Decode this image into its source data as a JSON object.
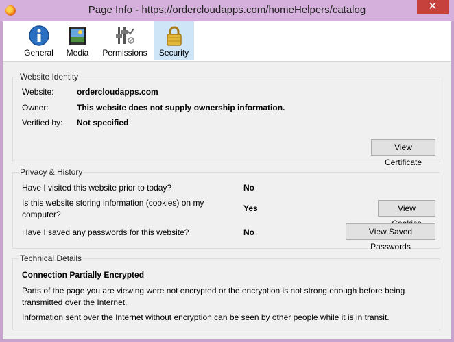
{
  "window": {
    "title": "Page Info - https://ordercloudapps.com/homeHelpers/catalog",
    "close_glyph": "✕"
  },
  "tabs": [
    {
      "label": "General",
      "icon": "info-icon"
    },
    {
      "label": "Media",
      "icon": "media-icon"
    },
    {
      "label": "Permissions",
      "icon": "permissions-icon"
    },
    {
      "label": "Security",
      "icon": "padlock-icon",
      "selected": true
    }
  ],
  "identity": {
    "legend": "Website Identity",
    "website_label": "Website:",
    "website_value": "ordercloudapps.com",
    "owner_label": "Owner:",
    "owner_value": "This website does not supply ownership information.",
    "verified_label": "Verified by:",
    "verified_value": "Not specified",
    "view_certificate": "View Certificate"
  },
  "privacy": {
    "legend": "Privacy & History",
    "visited_q": "Have I visited this website prior to today?",
    "visited_a": "No",
    "cookies_q_line1": "Is this website storing information (cookies) on my",
    "cookies_q_line2": "computer?",
    "cookies_a": "Yes",
    "view_cookies": "View Cookies",
    "passwords_q": "Have I saved any passwords for this website?",
    "passwords_a": "No",
    "view_passwords": "View Saved Passwords"
  },
  "technical": {
    "legend": "Technical Details",
    "heading": "Connection Partially Encrypted",
    "para1_line1": "Parts of the page you are viewing were not encrypted or the encryption is not strong enough before being",
    "para1_line2": "transmitted over the Internet.",
    "para2": "Information sent over the Internet without encryption can be seen by other people while it is in transit."
  }
}
